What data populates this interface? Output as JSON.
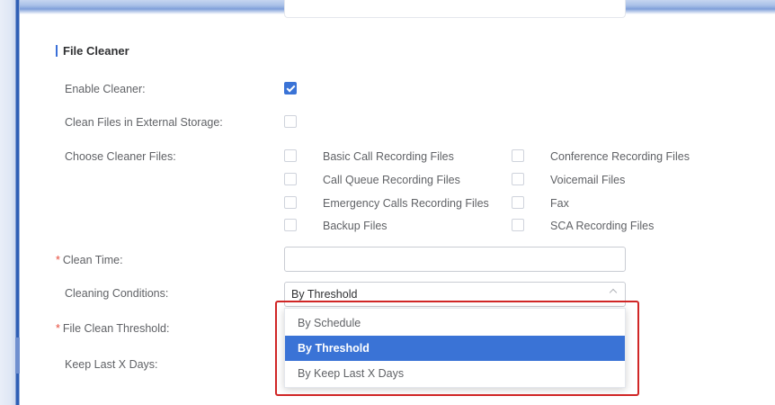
{
  "section": {
    "title": "File Cleaner"
  },
  "fields": {
    "enable_cleaner": {
      "label": "Enable Cleaner:",
      "checked": true
    },
    "clean_external": {
      "label": "Clean Files in External Storage:",
      "checked": false
    },
    "choose_files": {
      "label": "Choose Cleaner Files:"
    },
    "clean_time": {
      "label": "Clean Time:",
      "required": "*",
      "value": ""
    },
    "cleaning_conditions": {
      "label": "Cleaning Conditions:",
      "value": "By Threshold"
    },
    "file_clean_threshold": {
      "label": "File Clean Threshold:",
      "required": "*"
    },
    "keep_last_days": {
      "label": "Keep Last X Days:"
    }
  },
  "cleaner_files": [
    {
      "label": "Basic Call Recording Files",
      "checked": false
    },
    {
      "label": "Conference Recording Files",
      "checked": false
    },
    {
      "label": "Call Queue Recording Files",
      "checked": false
    },
    {
      "label": "Voicemail Files",
      "checked": false
    },
    {
      "label": "Emergency Calls Recording Files",
      "checked": false
    },
    {
      "label": "Fax",
      "checked": false
    },
    {
      "label": "Backup Files",
      "checked": false
    },
    {
      "label": "SCA Recording Files",
      "checked": false
    }
  ],
  "dropdown": {
    "options": [
      "By Schedule",
      "By Threshold",
      "By Keep Last X Days"
    ],
    "selected": "By Threshold"
  },
  "colors": {
    "accent": "#3a73d6",
    "highlight_box": "#d02626",
    "required": "#e74c3c"
  }
}
